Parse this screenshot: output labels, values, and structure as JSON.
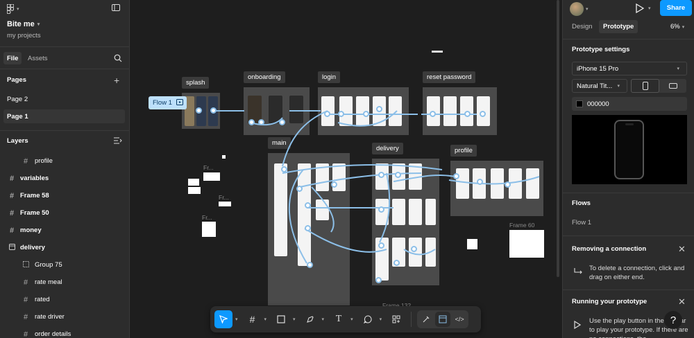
{
  "file": {
    "name": "Bite me",
    "location": "my projects"
  },
  "left_tabs": {
    "file": "File",
    "assets": "Assets"
  },
  "pages": {
    "heading": "Pages",
    "items": [
      "Page 2",
      "Page 1"
    ]
  },
  "layers": {
    "heading": "Layers",
    "items": [
      {
        "name": "profile",
        "kind": "frame",
        "indent": true
      },
      {
        "name": "variables",
        "kind": "frame",
        "indent": false
      },
      {
        "name": "Frame 58",
        "kind": "frame",
        "indent": false
      },
      {
        "name": "Frame 50",
        "kind": "frame",
        "indent": false
      },
      {
        "name": "money",
        "kind": "frame",
        "indent": false
      },
      {
        "name": "delivery",
        "kind": "section",
        "indent": false
      },
      {
        "name": "Group 75",
        "kind": "group",
        "indent": true
      },
      {
        "name": "rate meal",
        "kind": "frame",
        "indent": true
      },
      {
        "name": "rated",
        "kind": "frame",
        "indent": true
      },
      {
        "name": "rate driver",
        "kind": "frame",
        "indent": true
      },
      {
        "name": "order details",
        "kind": "frame",
        "indent": true
      }
    ]
  },
  "canvas": {
    "sections": {
      "splash": "splash",
      "onboarding": "onboarding",
      "login": "login",
      "reset": "reset password",
      "main": "main",
      "delivery": "delivery",
      "profile": "profile"
    },
    "flow_badge": "Flow 1",
    "frame_labels": {
      "frame60": "Frame 60",
      "frame132": "Frame 132",
      "fr": "Fr..."
    }
  },
  "right": {
    "tabs": {
      "design": "Design",
      "prototype": "Prototype"
    },
    "zoom": "6%",
    "share": "Share",
    "settings_heading": "Prototype settings",
    "device": "iPhone 15 Pro",
    "model": "Natural Tit...",
    "background": "000000",
    "flows_heading": "Flows",
    "flow_item": "Flow 1",
    "tip1": {
      "title": "Removing a connection",
      "body": "To delete a connection, click and drag on either end."
    },
    "tip2": {
      "title": "Running your prototype",
      "body": "Use the play button in the toolbar to play your prototype. If there are no connections, the"
    }
  },
  "colors": {
    "accent": "#0d99ff",
    "connector": "#8cbfe8",
    "panel": "#2c2c2c",
    "canvas": "#1e1e1e"
  }
}
